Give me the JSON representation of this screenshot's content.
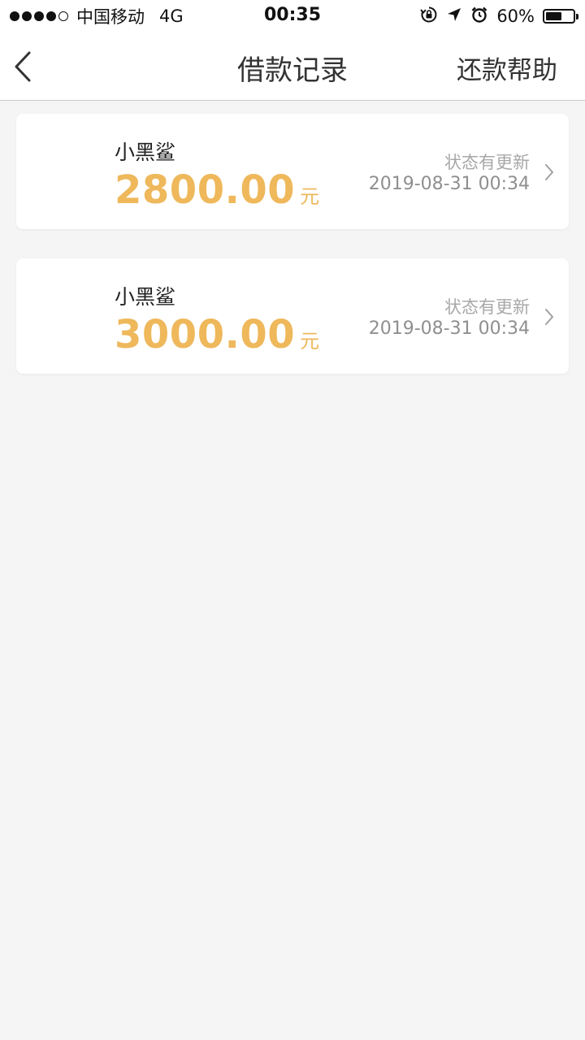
{
  "status_bar": {
    "carrier": "中国移动",
    "network": "4G",
    "time": "00:35",
    "battery_percent": "60%",
    "battery_level": 0.6,
    "signal_bars_filled": 4,
    "signal_bars_total": 5
  },
  "nav": {
    "title": "借款记录",
    "help_label": "还款帮助"
  },
  "records": [
    {
      "lender": "小黑鲨",
      "amount": "2800.00",
      "unit": "元",
      "status": "状态有更新",
      "datetime": "2019-08-31 00:34"
    },
    {
      "lender": "小黑鲨",
      "amount": "3000.00",
      "unit": "元",
      "status": "状态有更新",
      "datetime": "2019-08-31 00:34"
    }
  ],
  "colors": {
    "amount": "#eeb85b",
    "background": "#f6f5f5",
    "secondary_text": "#a8a8a8"
  }
}
